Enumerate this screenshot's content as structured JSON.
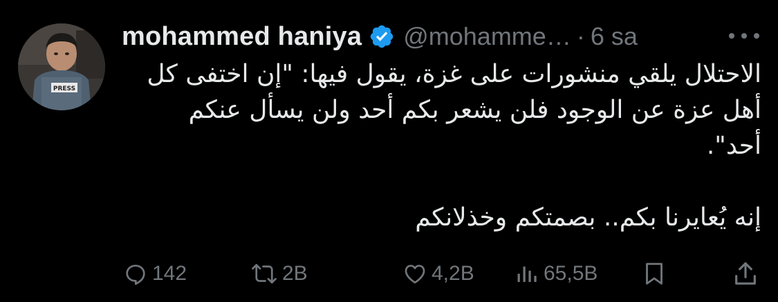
{
  "author": {
    "display_name": "mohammed haniya",
    "handle": "@mohamme…",
    "separator": "·",
    "time": "6 sa",
    "avatar_badge_text": "PRESS"
  },
  "tweet": {
    "lines": [
      "الاحتلال يلقي منشورات على غزة، يقول فيها: \"إن اختفى كل",
      "أهل عزة عن الوجود فلن يشعر بكم أحد ولن يسأل عنكم",
      "أحد\".",
      "",
      "إنه يُعايرنا بكم.. بصمتكم وخذلانكم"
    ]
  },
  "actions": {
    "replies": "142",
    "reposts": "2B",
    "likes": "4,2B",
    "views": "65,5B"
  },
  "icons": {
    "verified": "verified-badge-icon",
    "more": "more-options-icon",
    "reply": "reply-icon",
    "repost": "repost-icon",
    "like": "heart-icon",
    "views": "views-chart-icon",
    "bookmark": "bookmark-icon",
    "share": "share-icon"
  },
  "colors": {
    "background": "#000000",
    "text_primary": "#e7e9ea",
    "text_secondary": "#71767b",
    "verified_blue": "#1d9bf0"
  }
}
